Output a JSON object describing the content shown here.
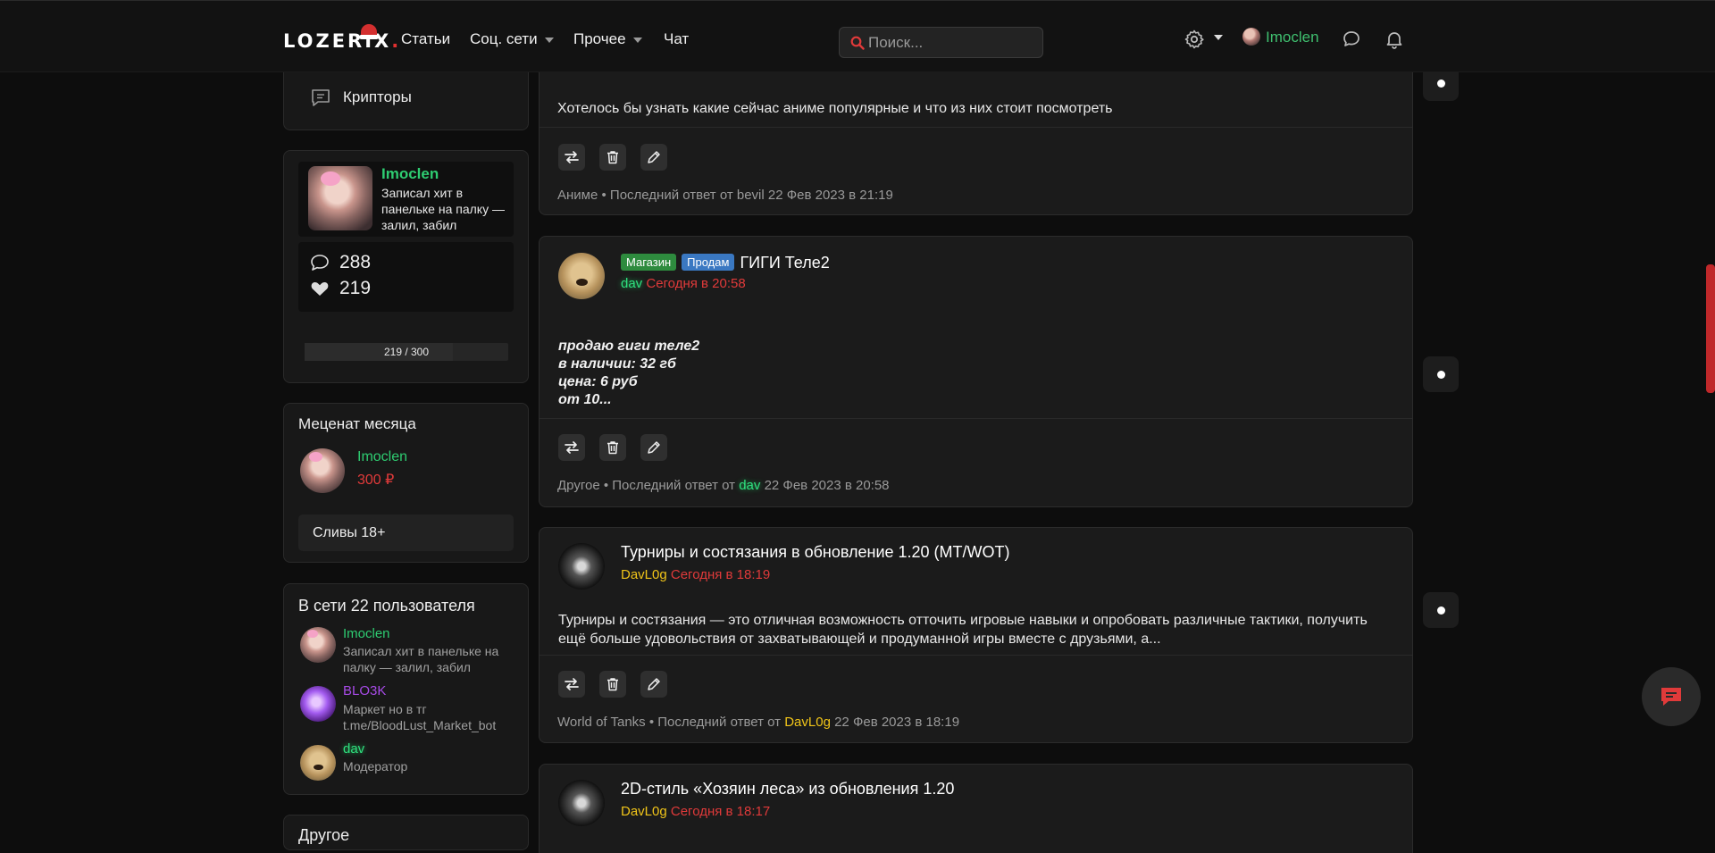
{
  "header": {
    "logo": "LOZERIX",
    "logo_dot": ".",
    "nav": [
      {
        "label": "Статьи"
      },
      {
        "label": "Соц. сети"
      },
      {
        "label": "Прочее"
      },
      {
        "label": "Чат"
      }
    ],
    "search_placeholder": "Поиск...",
    "user_name": "Imoclen"
  },
  "sidebar": {
    "top_item": "Крипторы",
    "profile": {
      "name": "Imoclen",
      "status": "Записал хит в панельке на палку — залил, забил",
      "messages": "288",
      "likes": "219",
      "progress_text": "219 / 300",
      "progress_fraction": 0.73
    },
    "patron": {
      "title": "Меценат месяца",
      "name": "Imoclen",
      "amount": "300 ₽",
      "link": "Сливы 18+"
    },
    "online": {
      "title": "В сети 22 пользователя",
      "users": [
        {
          "name": "Imoclen",
          "status": "Записал хит в панельке на палку — залил, забил"
        },
        {
          "name": "BLO3K",
          "status": "Маркет но в тг t.me/BloodLust_Market_bot"
        },
        {
          "name": "dav",
          "status": "Модератор"
        }
      ]
    },
    "next_card_title": "Другое"
  },
  "posts": [
    {
      "body": "Хотелось бы узнать какие сейчас аниме популярные и что из них стоит посмотреть",
      "meta_prefix": "Аниме • Последний ответ от bevil 22 Фев 2023 в 21:19"
    },
    {
      "tags": [
        "Магазин",
        "Продам"
      ],
      "title": "ГИГИ Теле2",
      "author": "dav",
      "time": "Сегодня в 20:58",
      "body_lines": [
        "продаю гиги теле2",
        "в наличии: 32 гб",
        "цена: 6 руб",
        "от 10..."
      ],
      "meta_prefix": "Другое • Последний ответ от",
      "meta_user": "dav",
      "meta_date": "22 Фев 2023 в 20:58"
    },
    {
      "title": "Турниры и состязания в обновление 1.20 (MT/WOT)",
      "author": "DavL0g",
      "time": "Сегодня в 18:19",
      "body": "Турниры и состязания — это отличная возможность отточить игровые навыки и опробовать различные тактики, получить ещё больше удовольствия от захватывающей и продуманной игры вместе с друзьями, а...",
      "meta_prefix": "World of Tanks • Последний ответ от",
      "meta_user": "DavL0g",
      "meta_date": "22 Фев 2023 в 18:19"
    },
    {
      "title": "2D-стиль «Хозяин леса» из обновления 1.20",
      "author": "DavL0g",
      "time": "Сегодня в 18:17"
    }
  ],
  "colors": {
    "accent_green": "#2ecc71",
    "time_red": "#e03a3a",
    "tag_shop": "#2e8b3e",
    "tag_sell": "#3a78c2",
    "author_yellow": "#f0c419"
  }
}
